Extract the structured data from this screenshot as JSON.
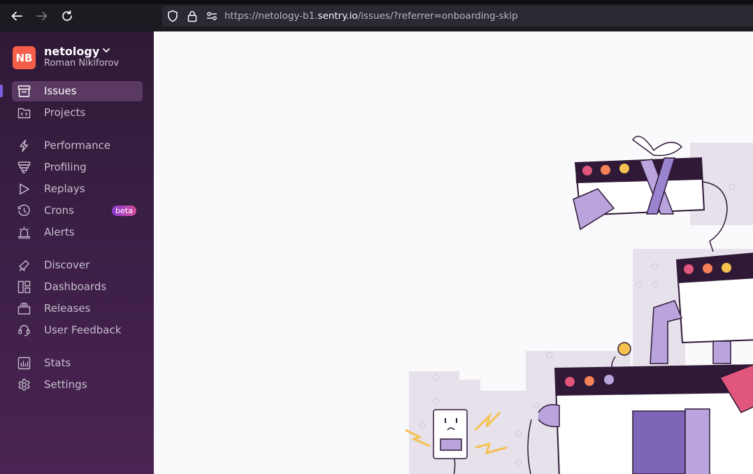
{
  "browser": {
    "url_prefix": "https://netology-b1.",
    "url_domain": "sentry.io",
    "url_path": "/issues/?referrer=onboarding-skip"
  },
  "org": {
    "initials": "NB",
    "name": "netology",
    "user": "Roman Nikiforov"
  },
  "sidebar": {
    "items": [
      {
        "label": "Issues",
        "icon": "issues-icon",
        "active": true
      },
      {
        "label": "Projects",
        "icon": "projects-icon"
      },
      {
        "label": "Performance",
        "icon": "lightning-icon"
      },
      {
        "label": "Profiling",
        "icon": "profiling-icon"
      },
      {
        "label": "Replays",
        "icon": "play-icon"
      },
      {
        "label": "Crons",
        "icon": "clock-icon",
        "badge": "beta"
      },
      {
        "label": "Alerts",
        "icon": "siren-icon"
      },
      {
        "label": "Discover",
        "icon": "telescope-icon"
      },
      {
        "label": "Dashboards",
        "icon": "dashboard-icon"
      },
      {
        "label": "Releases",
        "icon": "releases-icon"
      },
      {
        "label": "User Feedback",
        "icon": "megaphone-icon"
      },
      {
        "label": "Stats",
        "icon": "stats-icon"
      },
      {
        "label": "Settings",
        "icon": "gear-icon"
      }
    ]
  },
  "colors": {
    "accent": "#7c5ee0",
    "avatar": "#f55e48",
    "sidebar_top": "#2f1937",
    "sidebar_bottom": "#4a2452"
  }
}
